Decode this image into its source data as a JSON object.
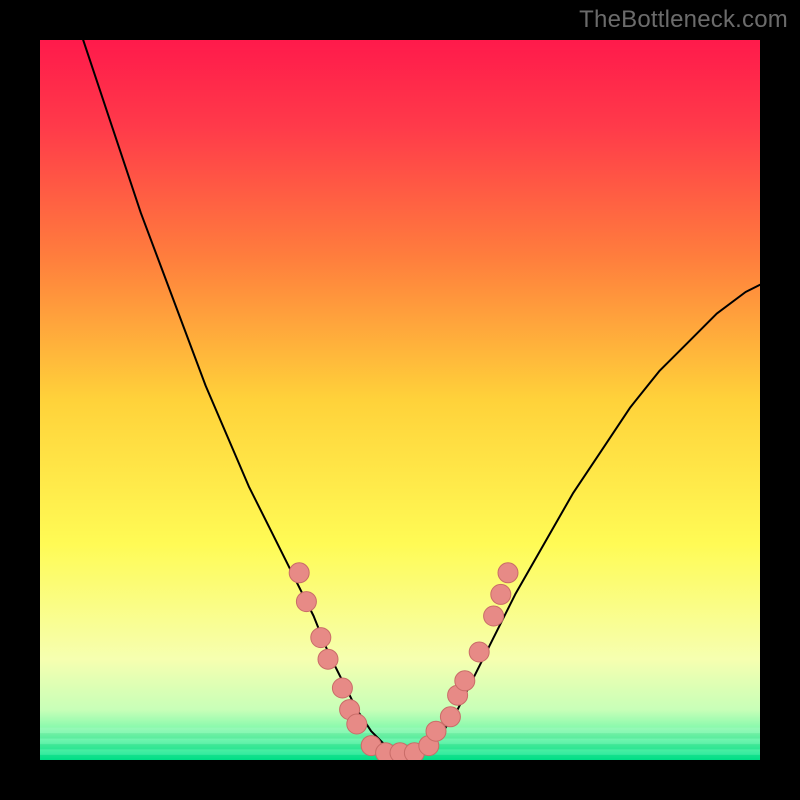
{
  "watermark": "TheBottleneck.com",
  "chart_data": {
    "type": "line",
    "title": "",
    "xlabel": "",
    "ylabel": "",
    "xlim": [
      0,
      100
    ],
    "ylim": [
      0,
      100
    ],
    "background": {
      "type": "vertical-gradient",
      "stops": [
        {
          "pos": 0.0,
          "color": "#ff1a4b"
        },
        {
          "pos": 0.12,
          "color": "#ff3a4a"
        },
        {
          "pos": 0.3,
          "color": "#ff7d3d"
        },
        {
          "pos": 0.5,
          "color": "#ffd23a"
        },
        {
          "pos": 0.7,
          "color": "#fffb55"
        },
        {
          "pos": 0.86,
          "color": "#f6ffb0"
        },
        {
          "pos": 0.93,
          "color": "#c8ffb8"
        },
        {
          "pos": 0.965,
          "color": "#70f7a8"
        },
        {
          "pos": 1.0,
          "color": "#00e58c"
        }
      ]
    },
    "series": [
      {
        "name": "bottleneck-curve",
        "color": "#000000",
        "stroke_width": 2,
        "x": [
          6,
          8,
          10,
          12,
          14,
          17,
          20,
          23,
          26,
          29,
          32,
          35,
          38,
          40,
          42,
          44,
          46,
          48,
          50,
          52,
          54,
          56,
          58,
          60,
          63,
          66,
          70,
          74,
          78,
          82,
          86,
          90,
          94,
          98,
          100
        ],
        "y": [
          100,
          94,
          88,
          82,
          76,
          68,
          60,
          52,
          45,
          38,
          32,
          26,
          20,
          15,
          11,
          7,
          4,
          2,
          1,
          1,
          2,
          4,
          7,
          11,
          17,
          23,
          30,
          37,
          43,
          49,
          54,
          58,
          62,
          65,
          66
        ]
      }
    ],
    "markers": {
      "name": "scatter-points",
      "color": "#e78a86",
      "stroke": "#c96c68",
      "radius": 10,
      "points": [
        {
          "x": 36,
          "y": 26
        },
        {
          "x": 37,
          "y": 22
        },
        {
          "x": 39,
          "y": 17
        },
        {
          "x": 40,
          "y": 14
        },
        {
          "x": 42,
          "y": 10
        },
        {
          "x": 43,
          "y": 7
        },
        {
          "x": 44,
          "y": 5
        },
        {
          "x": 46,
          "y": 2
        },
        {
          "x": 48,
          "y": 1
        },
        {
          "x": 50,
          "y": 1
        },
        {
          "x": 52,
          "y": 1
        },
        {
          "x": 54,
          "y": 2
        },
        {
          "x": 55,
          "y": 4
        },
        {
          "x": 57,
          "y": 6
        },
        {
          "x": 58,
          "y": 9
        },
        {
          "x": 59,
          "y": 11
        },
        {
          "x": 61,
          "y": 15
        },
        {
          "x": 63,
          "y": 20
        },
        {
          "x": 64,
          "y": 23
        },
        {
          "x": 65,
          "y": 26
        }
      ]
    }
  }
}
